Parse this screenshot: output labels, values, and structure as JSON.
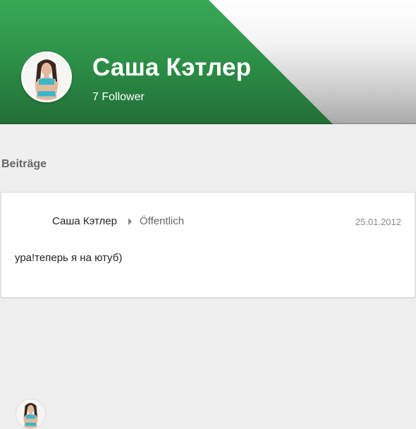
{
  "profile": {
    "name": "Саша Кэтлер",
    "followers": "7 Follower"
  },
  "section": {
    "title": "Beiträge"
  },
  "post": {
    "author": "Саша Кэтлер",
    "visibility": "Öffentlich",
    "date": "25.01.2012",
    "text": "ура!теперь я на ютуб)"
  },
  "colors": {
    "header_green": "#2c8f47",
    "page_background": "#efefef",
    "card_background": "#ffffff"
  },
  "icons": {
    "visibility_separator": "caret-right-icon"
  }
}
